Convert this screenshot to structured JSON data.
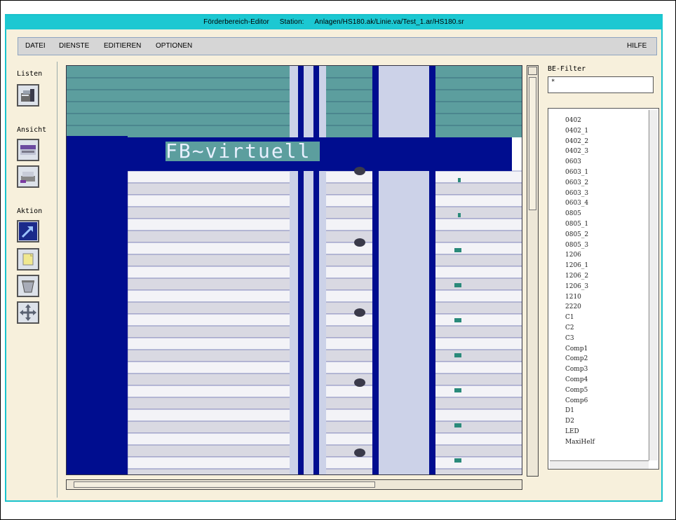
{
  "window": {
    "title": "Förderbereich-Editor",
    "station_label": "Station:",
    "station_path": "Anlagen/HS180.ak/Linie.va/Test_1.ar/HS180.sr"
  },
  "menu": {
    "datei": "DATEI",
    "dienste": "DIENSTE",
    "editieren": "EDITIEREN",
    "optionen": "OPTIONEN",
    "hilfe": "HILFE"
  },
  "toolbar": {
    "listen_label": "Listen",
    "ansicht_label": "Ansicht",
    "aktion_label": "Aktion"
  },
  "canvas": {
    "banner_text": "FB~virtuell",
    "colors": {
      "teal": "#5c9e9e",
      "navy": "#000d8f",
      "light_blue": "#ccd2e8",
      "mid_blue": "#6677b2",
      "row_light": "#f3f3f7",
      "row_dark": "#d9d9e2"
    }
  },
  "filter": {
    "label": "BE-Filter",
    "value": "*"
  },
  "be_list": [
    "0402",
    "0402_1",
    "0402_2",
    "0402_3",
    "0603",
    "0603_1",
    "0603_2",
    "0603_3",
    "0603_4",
    "0805",
    "0805_1",
    "0805_2",
    "0805_3",
    "1206",
    "1206_1",
    "1206_2",
    "1206_3",
    "1210",
    "2220",
    "C1",
    "C2",
    "C3",
    "Comp1",
    "Comp2",
    "Comp3",
    "Comp4",
    "Comp5",
    "Comp6",
    "D1",
    "D2",
    "LED",
    "MaxiHelf"
  ]
}
